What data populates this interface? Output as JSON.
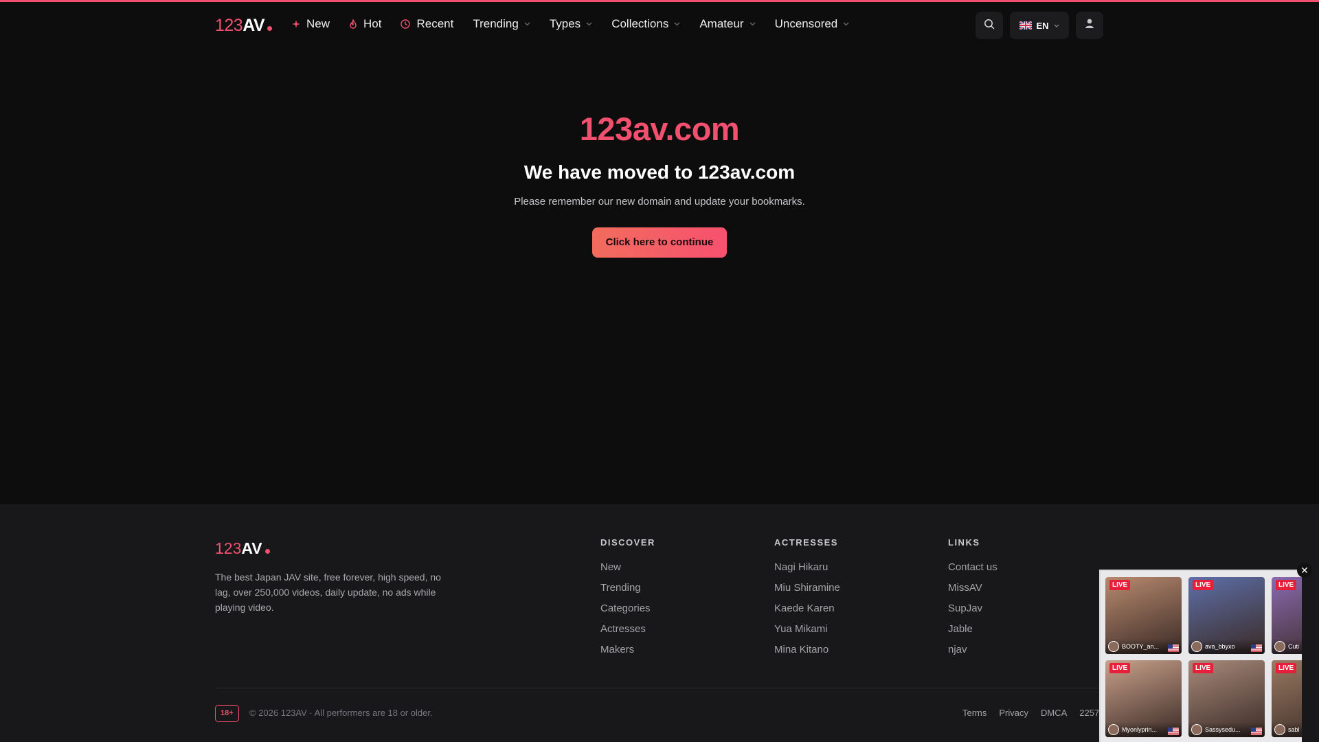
{
  "brand": {
    "num": "123",
    "av": "AV"
  },
  "nav": [
    {
      "label": "New",
      "icon": "sparkle-icon"
    },
    {
      "label": "Hot",
      "icon": "flame-icon"
    },
    {
      "label": "Recent",
      "icon": "clock-icon"
    },
    {
      "label": "Trending",
      "dropdown": true
    },
    {
      "label": "Types",
      "dropdown": true
    },
    {
      "label": "Collections",
      "dropdown": true
    },
    {
      "label": "Amateur",
      "dropdown": true
    },
    {
      "label": "Uncensored",
      "dropdown": true
    }
  ],
  "header": {
    "language": "EN"
  },
  "hero": {
    "domain": "123av.com",
    "title": "We have moved to 123av.com",
    "subtitle": "Please remember our new domain and update your bookmarks.",
    "button": "Click here to continue"
  },
  "footer": {
    "description": "The best Japan JAV site, free forever, high speed, no lag, over 250,000 videos, daily update, no ads while playing video.",
    "columns": [
      {
        "title": "DISCOVER",
        "links": [
          "New",
          "Trending",
          "Categories",
          "Actresses",
          "Makers"
        ]
      },
      {
        "title": "ACTRESSES",
        "links": [
          "Nagi Hikaru",
          "Miu Shiramine",
          "Kaede Karen",
          "Yua Mikami",
          "Mina Kitano"
        ]
      },
      {
        "title": "LINKS",
        "links": [
          "Contact us",
          "MissAV",
          "SupJav",
          "Jable",
          "njav"
        ]
      }
    ],
    "badge": "18+",
    "copyright": "© 2026 123AV · All performers are 18 or older.",
    "bottom_links": [
      "Terms",
      "Privacy",
      "DMCA",
      "2257"
    ]
  },
  "live_widget": {
    "tag": "LIVE",
    "cams": [
      {
        "name": "BOOTY_an...",
        "color": "#b88a6e"
      },
      {
        "name": "ava_bbyxo",
        "color": "#5e6fa8"
      },
      {
        "name": "Cuti",
        "color": "#8a6ab0"
      },
      {
        "name": "Myonlyprin...",
        "color": "#c9a18a"
      },
      {
        "name": "Sassysedu...",
        "color": "#a88a7a"
      },
      {
        "name": "sabl",
        "color": "#9a7a62"
      }
    ]
  }
}
